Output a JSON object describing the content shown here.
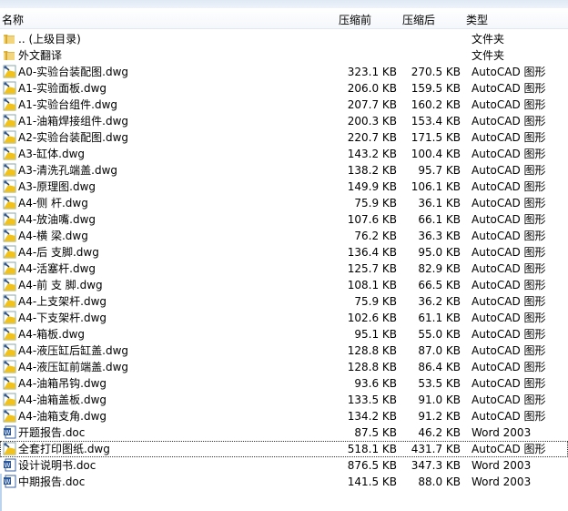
{
  "columns": {
    "name": "名称",
    "before": "压缩前",
    "after": "压缩后",
    "type": "类型"
  },
  "files": [
    {
      "name": ".. (上级目录)",
      "before": "",
      "after": "",
      "type": "文件夹",
      "icon": "folder"
    },
    {
      "name": "外文翻译",
      "before": "",
      "after": "",
      "type": "文件夹",
      "icon": "folder"
    },
    {
      "name": "A0-实验台装配图.dwg",
      "before": "323.1 KB",
      "after": "270.5 KB",
      "type": "AutoCAD 图形",
      "icon": "dwg"
    },
    {
      "name": "A1-实验面板.dwg",
      "before": "206.0 KB",
      "after": "159.5 KB",
      "type": "AutoCAD 图形",
      "icon": "dwg"
    },
    {
      "name": "A1-实验台组件.dwg",
      "before": "207.7 KB",
      "after": "160.2 KB",
      "type": "AutoCAD 图形",
      "icon": "dwg"
    },
    {
      "name": "A1-油箱焊接组件.dwg",
      "before": "200.3 KB",
      "after": "153.4 KB",
      "type": "AutoCAD 图形",
      "icon": "dwg"
    },
    {
      "name": "A2-实验台装配图.dwg",
      "before": "220.7 KB",
      "after": "171.5 KB",
      "type": "AutoCAD 图形",
      "icon": "dwg"
    },
    {
      "name": "A3-缸体.dwg",
      "before": "143.2 KB",
      "after": "100.4 KB",
      "type": "AutoCAD 图形",
      "icon": "dwg"
    },
    {
      "name": "A3-清洗孔端盖.dwg",
      "before": "138.2 KB",
      "after": "95.7 KB",
      "type": "AutoCAD 图形",
      "icon": "dwg"
    },
    {
      "name": "A3-原理图.dwg",
      "before": "149.9 KB",
      "after": "106.1 KB",
      "type": "AutoCAD 图形",
      "icon": "dwg"
    },
    {
      "name": "A4-侧 杆.dwg",
      "before": "75.9 KB",
      "after": "36.1 KB",
      "type": "AutoCAD 图形",
      "icon": "dwg"
    },
    {
      "name": "A4-放油嘴.dwg",
      "before": "107.6 KB",
      "after": "66.1 KB",
      "type": "AutoCAD 图形",
      "icon": "dwg"
    },
    {
      "name": "A4-横 梁.dwg",
      "before": "76.2 KB",
      "after": "36.3 KB",
      "type": "AutoCAD 图形",
      "icon": "dwg"
    },
    {
      "name": "A4-后 支脚.dwg",
      "before": "136.4 KB",
      "after": "95.0 KB",
      "type": "AutoCAD 图形",
      "icon": "dwg"
    },
    {
      "name": "A4-活塞杆.dwg",
      "before": "125.7 KB",
      "after": "82.9 KB",
      "type": "AutoCAD 图形",
      "icon": "dwg"
    },
    {
      "name": "A4-前 支 脚.dwg",
      "before": "108.1 KB",
      "after": "66.5 KB",
      "type": "AutoCAD 图形",
      "icon": "dwg"
    },
    {
      "name": "A4-上支架杆.dwg",
      "before": "75.9 KB",
      "after": "36.2 KB",
      "type": "AutoCAD 图形",
      "icon": "dwg"
    },
    {
      "name": "A4-下支架杆.dwg",
      "before": "102.6 KB",
      "after": "61.1 KB",
      "type": "AutoCAD 图形",
      "icon": "dwg"
    },
    {
      "name": "A4-箱板.dwg",
      "before": "95.1 KB",
      "after": "55.0 KB",
      "type": "AutoCAD 图形",
      "icon": "dwg"
    },
    {
      "name": "A4-液压缸后缸盖.dwg",
      "before": "128.8 KB",
      "after": "87.0 KB",
      "type": "AutoCAD 图形",
      "icon": "dwg"
    },
    {
      "name": "A4-液压缸前端盖.dwg",
      "before": "128.8 KB",
      "after": "86.4 KB",
      "type": "AutoCAD 图形",
      "icon": "dwg"
    },
    {
      "name": "A4-油箱吊钩.dwg",
      "before": "93.6 KB",
      "after": "53.5 KB",
      "type": "AutoCAD 图形",
      "icon": "dwg"
    },
    {
      "name": "A4-油箱盖板.dwg",
      "before": "133.5 KB",
      "after": "91.0 KB",
      "type": "AutoCAD 图形",
      "icon": "dwg"
    },
    {
      "name": "A4-油箱支角.dwg",
      "before": "134.2 KB",
      "after": "91.2 KB",
      "type": "AutoCAD 图形",
      "icon": "dwg"
    },
    {
      "name": "开题报告.doc",
      "before": "87.5 KB",
      "after": "46.2 KB",
      "type": "Word 2003",
      "icon": "doc"
    },
    {
      "name": "全套打印图纸.dwg",
      "before": "518.1 KB",
      "after": "431.7 KB",
      "type": "AutoCAD 图形",
      "icon": "dwg",
      "selected": true
    },
    {
      "name": "设计说明书.doc",
      "before": "876.5 KB",
      "after": "347.3 KB",
      "type": "Word 2003",
      "icon": "doc"
    },
    {
      "name": "中期报告.doc",
      "before": "141.5 KB",
      "after": "88.0 KB",
      "type": "Word 2003",
      "icon": "doc"
    }
  ]
}
